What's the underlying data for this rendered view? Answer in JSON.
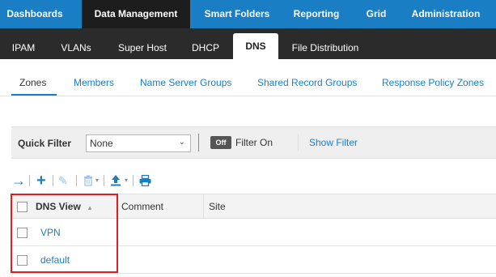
{
  "topnav": {
    "items": [
      {
        "label": "Dashboards"
      },
      {
        "label": "Data Management"
      },
      {
        "label": "Smart Folders"
      },
      {
        "label": "Reporting"
      },
      {
        "label": "Grid"
      },
      {
        "label": "Administration"
      }
    ],
    "active": "Data Management"
  },
  "subnav": {
    "items": [
      {
        "label": "IPAM"
      },
      {
        "label": "VLANs"
      },
      {
        "label": "Super Host"
      },
      {
        "label": "DHCP"
      },
      {
        "label": "DNS"
      },
      {
        "label": "File Distribution"
      }
    ],
    "active": "DNS"
  },
  "tabs": {
    "items": [
      {
        "label": "Zones"
      },
      {
        "label": "Members"
      },
      {
        "label": "Name Server Groups"
      },
      {
        "label": "Shared Record Groups"
      },
      {
        "label": "Response Policy Zones"
      }
    ],
    "active": "Zones"
  },
  "filter": {
    "label": "Quick Filter",
    "selected": "None",
    "toggle_label": "Off",
    "toggle_text": "Filter On",
    "show_filter": "Show Filter"
  },
  "toolbar": {
    "icons": [
      "arrow-right-icon",
      "add-icon",
      "edit-icon",
      "delete-icon",
      "export-icon",
      "print-icon"
    ]
  },
  "grid": {
    "columns": [
      {
        "label": "DNS View",
        "sort": "ascending"
      },
      {
        "label": "Comment"
      },
      {
        "label": "Site"
      }
    ],
    "rows": [
      {
        "dns_view": "VPN"
      },
      {
        "dns_view": "default"
      }
    ]
  },
  "colors": {
    "brand_blue": "#1a7ec4",
    "dark_nav": "#2b2b2b",
    "highlight": "#e02020"
  }
}
